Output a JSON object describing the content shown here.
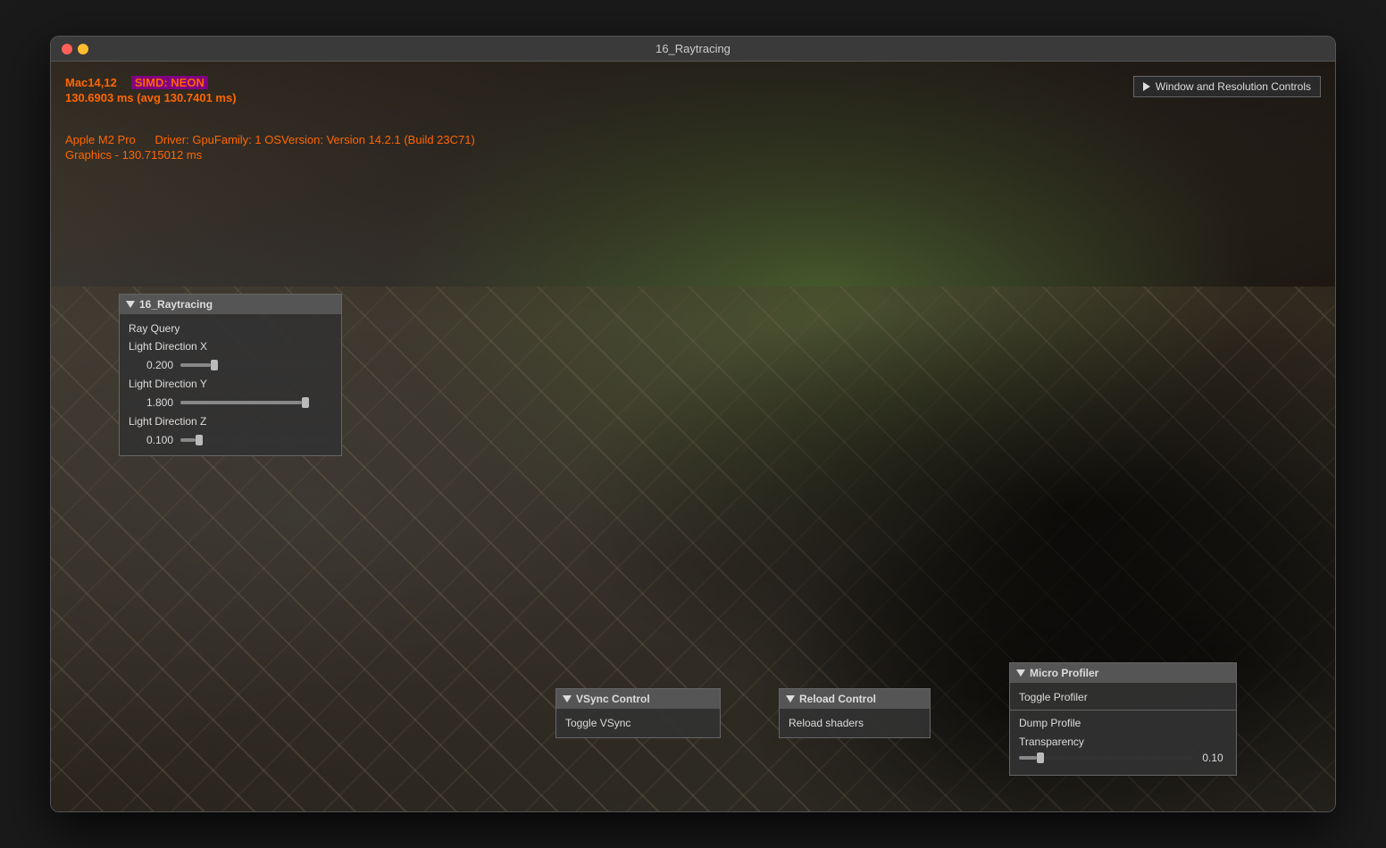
{
  "window": {
    "title": "16_Raytracing"
  },
  "hud": {
    "platform": "Mac14,12",
    "simd": "SIMD: NEON",
    "timing": "130.6903 ms (avg 130.7401 ms)",
    "gpu": "Apple M2 Pro",
    "driver": "Driver: GpuFamily: 1 OSVersion: Version 14.2.1 (Build 23C71)",
    "graphics_timing": "Graphics - 130.715012 ms"
  },
  "top_right_button": {
    "label": "Window and Resolution Controls"
  },
  "panel_raytracing": {
    "title": "16_Raytracing",
    "items": [
      {
        "label": "Ray Query",
        "type": "label"
      },
      {
        "label": "Light Direction X",
        "type": "slider",
        "value": "0.200",
        "fill_pct": 20
      },
      {
        "label": "Light Direction Y",
        "type": "slider",
        "value": "1.800",
        "fill_pct": 80
      },
      {
        "label": "Light Direction Z",
        "type": "slider",
        "value": "0.100",
        "fill_pct": 10
      }
    ]
  },
  "panel_vsync": {
    "title": "VSync Control",
    "button_label": "Toggle VSync"
  },
  "panel_reload": {
    "title": "Reload Control",
    "button_label": "Reload shaders"
  },
  "panel_microprofiler": {
    "title": "Micro Profiler",
    "toggle_label": "Toggle Profiler",
    "dump_label": "Dump Profile",
    "transparency_label": "Transparency",
    "transparency_value": "0.10",
    "transparency_fill_pct": 10
  }
}
